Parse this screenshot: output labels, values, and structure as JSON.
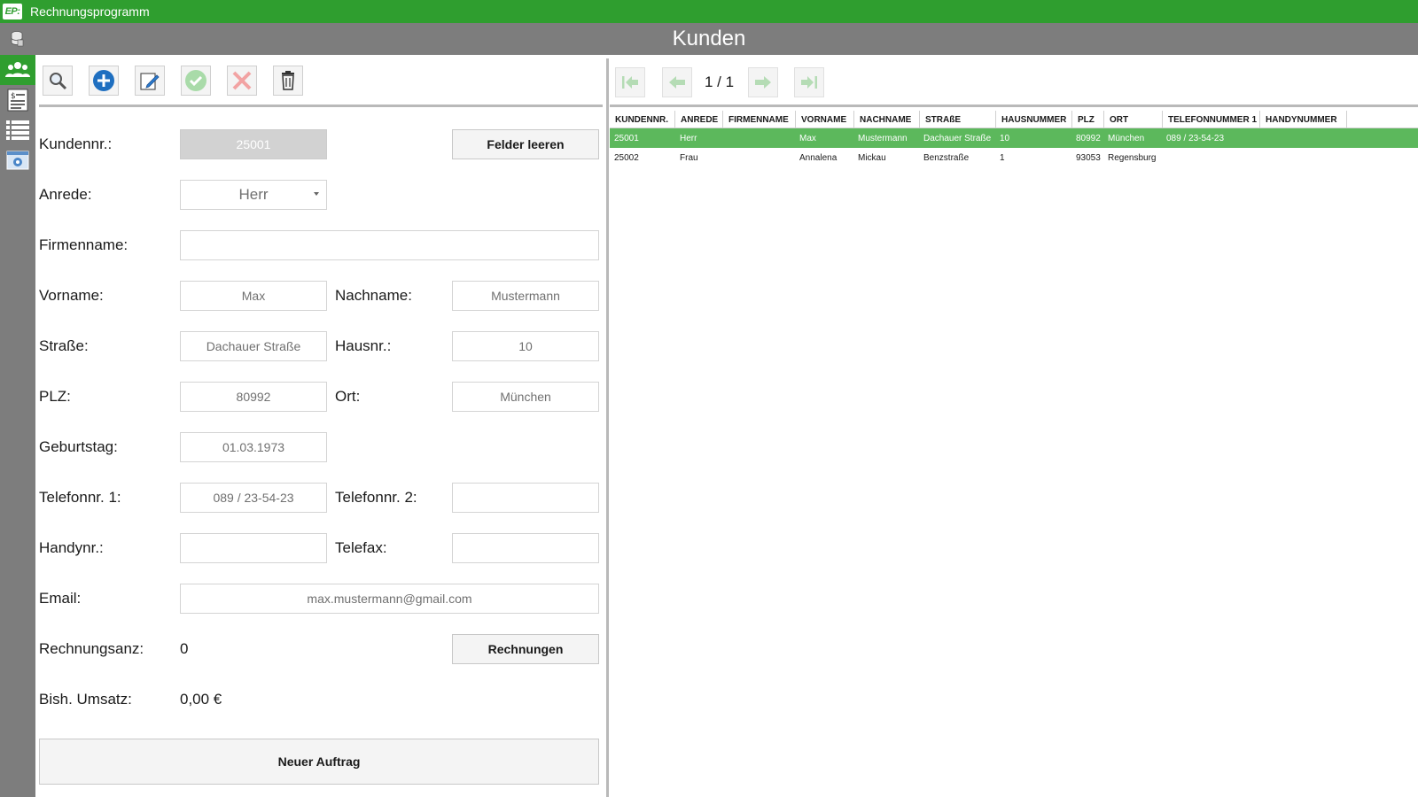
{
  "app": {
    "logo": "EP:",
    "title": "Rechnungsprogramm"
  },
  "header": {
    "title": "Kunden"
  },
  "sidebar": {
    "items": [
      {
        "name": "customers",
        "icon": "users-icon",
        "active": true
      },
      {
        "name": "invoices",
        "icon": "invoice-icon",
        "active": false
      },
      {
        "name": "list",
        "icon": "list-icon",
        "active": false
      },
      {
        "name": "settings",
        "icon": "settings-window-icon",
        "active": false
      }
    ]
  },
  "toolbar": {
    "buttons": [
      "search-icon",
      "add-icon",
      "edit-icon",
      "confirm-icon",
      "cancel-icon",
      "delete-icon"
    ]
  },
  "form": {
    "kundennr_label": "Kundennr.:",
    "kundennr_value": "25001",
    "clear_button": "Felder leeren",
    "anrede_label": "Anrede:",
    "anrede_value": "Herr",
    "firmenname_label": "Firmenname:",
    "firmenname_value": "",
    "vorname_label": "Vorname:",
    "vorname_value": "Max",
    "nachname_label": "Nachname:",
    "nachname_value": "Mustermann",
    "strasse_label": "Straße:",
    "strasse_value": "Dachauer Straße",
    "hausnr_label": "Hausnr.:",
    "hausnr_value": "10",
    "plz_label": "PLZ:",
    "plz_value": "80992",
    "ort_label": "Ort:",
    "ort_value": "München",
    "geburtstag_label": "Geburtstag:",
    "geburtstag_value": "01.03.1973",
    "telefon1_label": "Telefonnr. 1:",
    "telefon1_value": "089 / 23-54-23",
    "telefon2_label": "Telefonnr. 2:",
    "telefon2_value": "",
    "handy_label": "Handynr.:",
    "handy_value": "",
    "telefax_label": "Telefax:",
    "telefax_value": "",
    "email_label": "Email:",
    "email_value": "max.mustermann@gmail.com",
    "rechnungsanz_label": "Rechnungsanz:",
    "rechnungsanz_value": "0",
    "rechnungen_button": "Rechnungen",
    "umsatz_label": "Bish. Umsatz:",
    "umsatz_value": "0,00 €",
    "neuer_auftrag_button": "Neuer Auftrag"
  },
  "pager": {
    "counter": "1 / 1"
  },
  "grid": {
    "columns": [
      "KUNDENNR.",
      "ANREDE",
      "FIRMENNAME",
      "VORNAME",
      "NACHNAME",
      "STRAßE",
      "HAUSNUMMER",
      "PLZ",
      "ORT",
      "TELEFONNUMMER 1",
      "HANDYNUMMER"
    ],
    "rows": [
      [
        "25001",
        "Herr",
        "",
        "Max",
        "Mustermann",
        "Dachauer Straße",
        "10",
        "80992",
        "München",
        "089 / 23-54-23",
        ""
      ],
      [
        "25002",
        "Frau",
        "",
        "Annalena",
        "Mickau",
        "Benzstraße",
        "1",
        "93053",
        "Regensburg",
        "",
        ""
      ]
    ],
    "selected_row": 0,
    "selection_color": "#5cb85c"
  },
  "colors": {
    "accent": "#2f9e2f",
    "chrome": "#7d7d7d"
  }
}
